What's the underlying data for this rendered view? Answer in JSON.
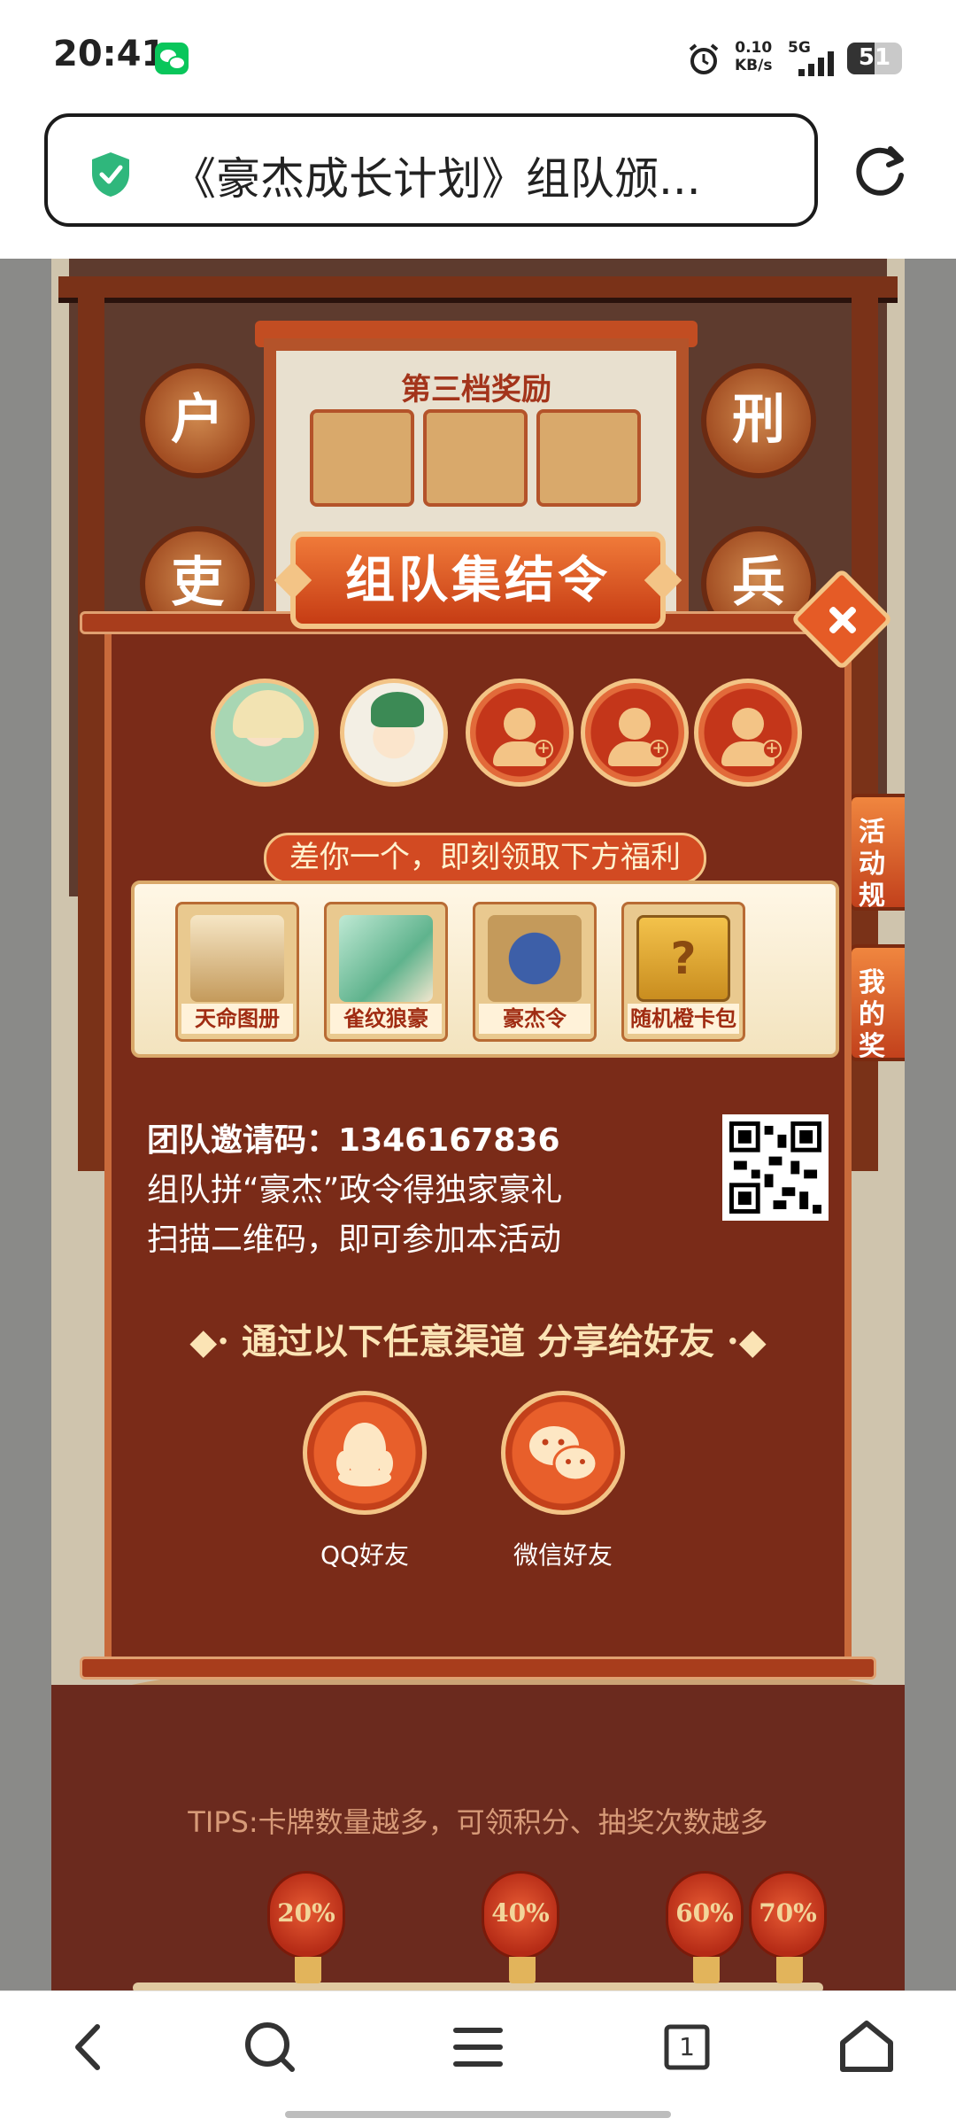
{
  "status_bar": {
    "time": "20:41",
    "net_speed_value": "0.10",
    "net_speed_unit": "KB/s",
    "network": "5G",
    "battery": "51"
  },
  "browser": {
    "page_title": "《豪杰成长计划》组队颁..."
  },
  "background": {
    "reward_panel_title": "第三档奖励",
    "departments": [
      "户",
      "刑",
      "吏",
      "兵"
    ],
    "side_tabs": [
      "活动\n规则",
      "我的\n奖品"
    ],
    "tips": "TIPS:卡牌数量越多，可领积分、抽奖次数越多",
    "milestones": [
      "20%",
      "40%",
      "60%",
      "70%"
    ]
  },
  "modal": {
    "title": "组队集结令",
    "promo": "差你一个，即刻领取下方福利",
    "rewards": [
      "天命图册",
      "雀纹狼豪",
      "豪杰令",
      "随机橙卡包"
    ],
    "invite_label": "团队邀请码：",
    "invite_code": "1346167836",
    "info_lines": [
      "组队拼“豪杰”政令得独家豪礼",
      "扫描二维码，即可参加本活动"
    ],
    "share_heading": "通过以下任意渠道 分享给好友",
    "share_options": [
      "QQ好友",
      "微信好友"
    ]
  },
  "colors": {
    "modal_body": "#7a2b18",
    "accent_orange": "#e85f2b",
    "gold": "#f3c486"
  },
  "icons": {
    "status": [
      "wechat-icon",
      "alarm-icon",
      "signal-icon",
      "battery-icon"
    ],
    "browser": [
      "shield-icon",
      "reload-icon"
    ],
    "nav": [
      "back-icon",
      "search-icon",
      "menu-icon",
      "tabs-icon",
      "home-icon"
    ],
    "share": [
      "qq-icon",
      "wechat-icon"
    ]
  },
  "bottom_nav": {
    "tab_count": "1"
  }
}
